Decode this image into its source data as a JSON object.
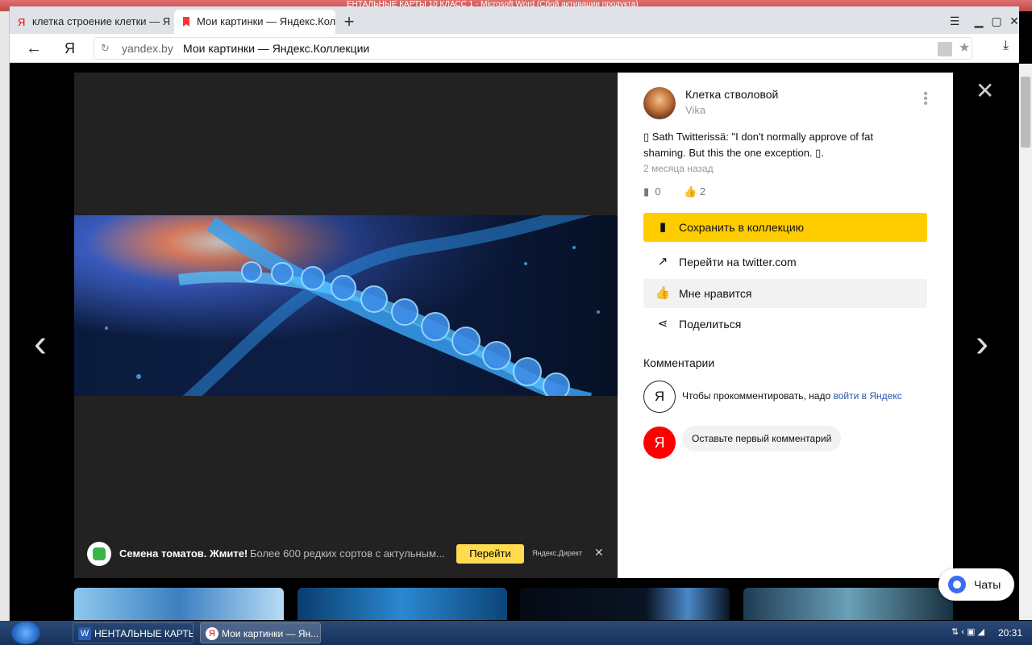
{
  "background": {
    "window_title": "ЕНТАЛЬНЫЕ КАРТЫ 10 КЛАСС 1 - Microsoft Word (Сбой активации продукта)"
  },
  "browser": {
    "tabs": [
      {
        "label": "клетка строение клетки — Я",
        "active": false
      },
      {
        "label": "Мои картинки — Яндекс.Колл",
        "active": true
      }
    ],
    "new_tab": "+",
    "address": {
      "domain": "yandex.by",
      "title": "Мои картинки — Яндекс.Коллекции"
    }
  },
  "viewer": {
    "prev": "‹",
    "next": "›",
    "close": "✕"
  },
  "ad": {
    "title": "Семена томатов. Жмите!",
    "desc": "Более 600 редких сортов с актульным...",
    "button": "Перейти",
    "source": "Яндекс.Директ",
    "close": "✕"
  },
  "panel": {
    "collection_name": "Клетка стволовой",
    "author": "Vika",
    "description": "▯ Sath Twitterissä: \"I don't normally approve of fat shaming. But this the one exception. ▯.",
    "date": "2 месяца назад",
    "saves_count": "0",
    "likes_count": "2",
    "actions": {
      "save": "Сохранить в коллекцию",
      "goto": "Перейти на twitter.com",
      "like": "Мне нравится",
      "share": "Поделиться"
    },
    "comments_heading": "Комментарии",
    "login_prompt": "Чтобы прокомментировать, надо ",
    "login_link": "войти в Яндекс",
    "first_comment": "Оставьте первый комментарий",
    "avatar_letter": "Я"
  },
  "chats": {
    "label": "Чаты"
  },
  "taskbar": {
    "tasks": [
      {
        "label": "НЕНТАЛЬНЫЕ КАРТЫ...",
        "icon": "W"
      },
      {
        "label": "Мои картинки — Ян...",
        "icon": "Я"
      }
    ],
    "clock": "20:31"
  },
  "colors": {
    "accent": "#ffcc00",
    "yandex_red": "#ff0000",
    "like_green": "#2fb24a",
    "link": "#2a56a8"
  }
}
